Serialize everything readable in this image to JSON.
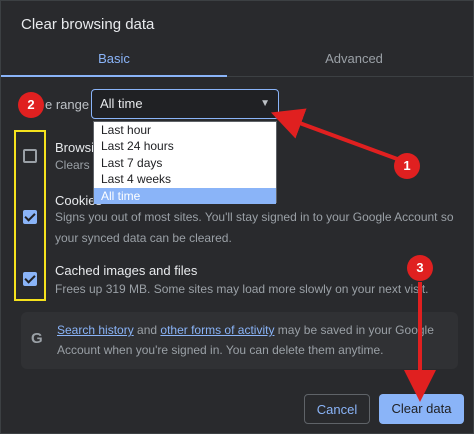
{
  "dialog": {
    "title": "Clear browsing data",
    "tabs": [
      {
        "label": "Basic"
      },
      {
        "label": "Advanced"
      }
    ]
  },
  "time_range": {
    "label_visible": "e range",
    "selected": "All time",
    "options": [
      "Last hour",
      "Last 24 hours",
      "Last 7 days",
      "Last 4 weeks",
      "All time"
    ]
  },
  "items": [
    {
      "title": "Browsin",
      "desc": "Clears l",
      "checked": false
    },
    {
      "title": "Cookies",
      "desc": "Signs you out of most sites. You'll stay signed in to your Google Account so",
      "desc2": "your synced data can be cleared.",
      "checked": true
    },
    {
      "title": "Cached images and files",
      "desc": "Frees up 319 MB. Some sites may load more slowly on your next visit.",
      "checked": true
    }
  ],
  "info": {
    "link1": "Search history",
    "and": " and ",
    "link2": "other forms of activity",
    "line1_rest": " may be saved in your Google",
    "line2": "Account when you're signed in. You can delete them anytime.",
    "icon": "G"
  },
  "buttons": {
    "cancel": "Cancel",
    "clear": "Clear data"
  },
  "annotations": {
    "badge1": "1",
    "badge2": "2",
    "badge3": "3",
    "badge_color": "#e02020",
    "highlight_color": "#f5e21d"
  }
}
